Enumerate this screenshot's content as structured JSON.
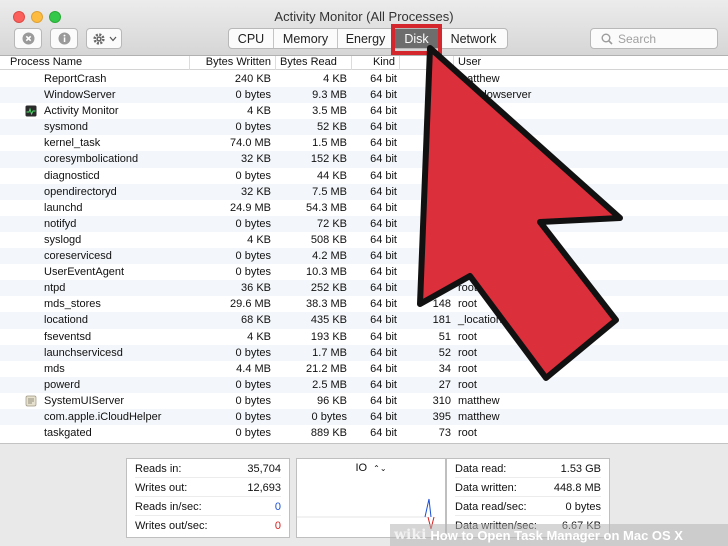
{
  "window": {
    "title": "Activity Monitor (All Processes)"
  },
  "toolbar": {
    "tabs": [
      {
        "label": "CPU",
        "active": false
      },
      {
        "label": "Memory",
        "active": false
      },
      {
        "label": "Energy",
        "active": false
      },
      {
        "label": "Disk",
        "active": true
      },
      {
        "label": "Network",
        "active": false
      }
    ],
    "search_placeholder": "Search"
  },
  "table": {
    "headers": {
      "process_name": "Process Name",
      "bytes_written": "Bytes Written",
      "bytes_read": "Bytes Read",
      "kind": "Kind",
      "pid": "",
      "user": "User"
    },
    "rows": [
      {
        "name": "ReportCrash",
        "written": "240 KB",
        "read": "4 KB",
        "kind": "64 bit",
        "pid": "",
        "user": "matthew",
        "icon": ""
      },
      {
        "name": "WindowServer",
        "written": "0 bytes",
        "read": "9.3 MB",
        "kind": "64 bit",
        "pid": "",
        "user": "_windowserver",
        "icon": ""
      },
      {
        "name": "Activity Monitor",
        "written": "4 KB",
        "read": "3.5 MB",
        "kind": "64 bit",
        "pid": "",
        "user": "",
        "icon": "activity-monitor-icon"
      },
      {
        "name": "sysmond",
        "written": "0 bytes",
        "read": "52 KB",
        "kind": "64 bit",
        "pid": "",
        "user": "",
        "icon": ""
      },
      {
        "name": "kernel_task",
        "written": "74.0 MB",
        "read": "1.5 MB",
        "kind": "64 bit",
        "pid": "",
        "user": "",
        "icon": ""
      },
      {
        "name": "coresymbolicationd",
        "written": "32 KB",
        "read": "152 KB",
        "kind": "64 bit",
        "pid": "",
        "user": "",
        "icon": ""
      },
      {
        "name": "diagnosticd",
        "written": "0 bytes",
        "read": "44 KB",
        "kind": "64 bit",
        "pid": "",
        "user": "",
        "icon": ""
      },
      {
        "name": "opendirectoryd",
        "written": "32 KB",
        "read": "7.5 MB",
        "kind": "64 bit",
        "pid": "",
        "user": "",
        "icon": ""
      },
      {
        "name": "launchd",
        "written": "24.9 MB",
        "read": "54.3 MB",
        "kind": "64 bit",
        "pid": "",
        "user": "",
        "icon": ""
      },
      {
        "name": "notifyd",
        "written": "0 bytes",
        "read": "72 KB",
        "kind": "64 bit",
        "pid": "",
        "user": "",
        "icon": ""
      },
      {
        "name": "syslogd",
        "written": "4 KB",
        "read": "508 KB",
        "kind": "64 bit",
        "pid": "",
        "user": "",
        "icon": ""
      },
      {
        "name": "coreservicesd",
        "written": "0 bytes",
        "read": "4.2 MB",
        "kind": "64 bit",
        "pid": "",
        "user": "",
        "icon": ""
      },
      {
        "name": "UserEventAgent",
        "written": "0 bytes",
        "read": "10.3 MB",
        "kind": "64 bit",
        "pid": "",
        "user": "root",
        "icon": ""
      },
      {
        "name": "ntpd",
        "written": "36 KB",
        "read": "252 KB",
        "kind": "64 bit",
        "pid": "",
        "user": "root",
        "icon": ""
      },
      {
        "name": "mds_stores",
        "written": "29.6 MB",
        "read": "38.3 MB",
        "kind": "64 bit",
        "pid": "148",
        "user": "root",
        "icon": ""
      },
      {
        "name": "locationd",
        "written": "68 KB",
        "read": "435 KB",
        "kind": "64 bit",
        "pid": "181",
        "user": "_locationd",
        "icon": ""
      },
      {
        "name": "fseventsd",
        "written": "4 KB",
        "read": "193 KB",
        "kind": "64 bit",
        "pid": "51",
        "user": "root",
        "icon": ""
      },
      {
        "name": "launchservicesd",
        "written": "0 bytes",
        "read": "1.7 MB",
        "kind": "64 bit",
        "pid": "52",
        "user": "root",
        "icon": ""
      },
      {
        "name": "mds",
        "written": "4.4 MB",
        "read": "21.2 MB",
        "kind": "64 bit",
        "pid": "34",
        "user": "root",
        "icon": ""
      },
      {
        "name": "powerd",
        "written": "0 bytes",
        "read": "2.5 MB",
        "kind": "64 bit",
        "pid": "27",
        "user": "root",
        "icon": ""
      },
      {
        "name": "SystemUIServer",
        "written": "0 bytes",
        "read": "96 KB",
        "kind": "64 bit",
        "pid": "310",
        "user": "matthew",
        "icon": "systemuiserver-icon"
      },
      {
        "name": "com.apple.iCloudHelper",
        "written": "0 bytes",
        "read": "0 bytes",
        "kind": "64 bit",
        "pid": "395",
        "user": "matthew",
        "icon": ""
      },
      {
        "name": "taskgated",
        "written": "0 bytes",
        "read": "889 KB",
        "kind": "64 bit",
        "pid": "73",
        "user": "root",
        "icon": ""
      }
    ]
  },
  "stats_left": [
    {
      "label": "Reads in:",
      "value": "35,704",
      "color": "#111111"
    },
    {
      "label": "Writes out:",
      "value": "12,693",
      "color": "#111111"
    },
    {
      "label": "Reads in/sec:",
      "value": "0",
      "color": "#1a4fd6"
    },
    {
      "label": "Writes out/sec:",
      "value": "0",
      "color": "#d62020"
    }
  ],
  "io_graph": {
    "label": "IO",
    "selector_symbol": "⌃⌄"
  },
  "stats_right": [
    {
      "label": "Data read:",
      "value": "1.53 GB"
    },
    {
      "label": "Data written:",
      "value": "448.8 MB"
    },
    {
      "label": "Data read/sec:",
      "value": "0 bytes"
    },
    {
      "label": "Data written/sec:",
      "value": "6.67 KB"
    }
  ],
  "watermark": {
    "brand": "wiki",
    "caption": "How to Open Task Manager on Mac OS X"
  },
  "colors": {
    "arrow_red": "#dc2f3c",
    "highlight_red": "#d4262d"
  }
}
